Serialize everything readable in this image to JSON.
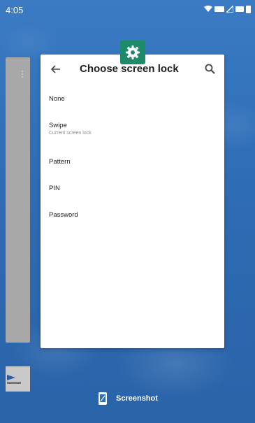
{
  "status_bar": {
    "time": "4:05",
    "icons": [
      "wifi-icon",
      "data-icon",
      "signal-icon",
      "lte-icon",
      "battery-icon"
    ]
  },
  "settings_card": {
    "title": "Choose screen lock",
    "back_icon": "arrow-left-icon",
    "search_icon": "search-icon",
    "app_icon": "settings-gear-icon",
    "app_icon_color": "#1d8a6a",
    "options": [
      {
        "label": "None",
        "summary": ""
      },
      {
        "label": "Swipe",
        "summary": "Current screen lock"
      },
      {
        "label": "Pattern",
        "summary": ""
      },
      {
        "label": "PIN",
        "summary": ""
      },
      {
        "label": "Password",
        "summary": ""
      }
    ]
  },
  "screenshot_action": {
    "label": "Screenshot",
    "icon": "screenshot-phone-icon"
  },
  "colors": {
    "wallpaper": "#2f6fb8",
    "card_bg": "#ffffff",
    "side_card": "#a8a8a8"
  }
}
